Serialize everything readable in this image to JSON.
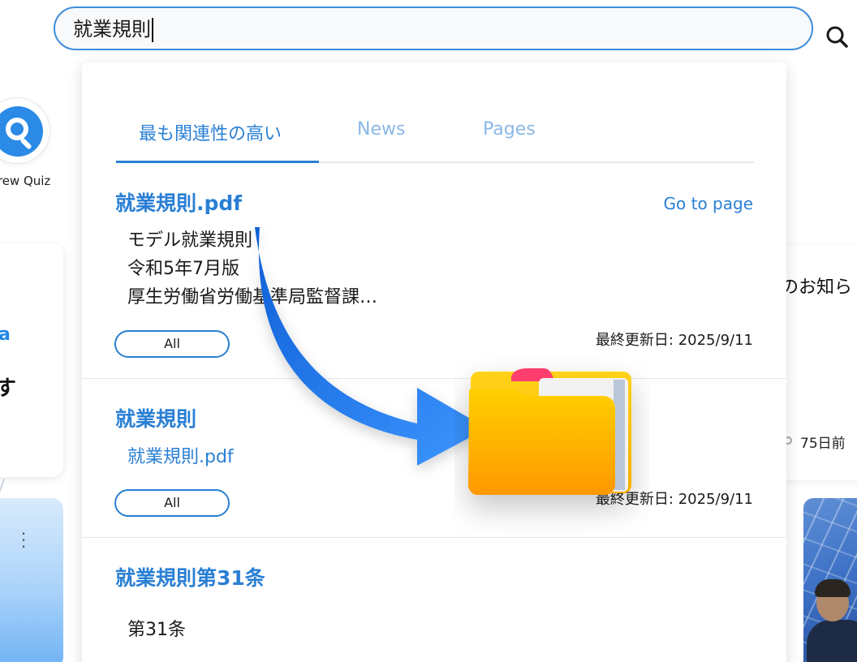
{
  "search": {
    "query": "就業規則",
    "icon": "search-icon"
  },
  "background": {
    "quiz_label": "rkrew Quiz",
    "card_fragment_a": "a",
    "card_fragment_su": "す",
    "notice_fragment": "のお知ら",
    "days_ago": "75日前"
  },
  "tabs": [
    {
      "label": "最も関連性の高い",
      "active": true
    },
    {
      "label": "News",
      "active": false
    },
    {
      "label": "Pages",
      "active": false
    }
  ],
  "results": [
    {
      "title": "就業規則.pdf",
      "goto_label": "Go to page",
      "lines": [
        "モデル就業規則",
        "令和5年7月版",
        "厚生労働省労働基準局監督課…"
      ],
      "tag": "All",
      "updated": "最終更新日: 2025/9/11"
    },
    {
      "title": "就業規則",
      "link": "就業規則.pdf",
      "tag": "All",
      "updated": "最終更新日: 2025/9/11"
    },
    {
      "title": "就業規則第31条",
      "lines": [
        "第31条"
      ]
    }
  ],
  "colors": {
    "accent": "#2a7fd4",
    "tab_inactive": "#8ab8e6",
    "search_border": "#3d8ddc",
    "arrow": "#1e78f0",
    "folder": "#ffc400",
    "folder_tab": "#ff3d6e"
  },
  "overlay_icons": [
    "curved-arrow-icon",
    "folder-icon"
  ]
}
